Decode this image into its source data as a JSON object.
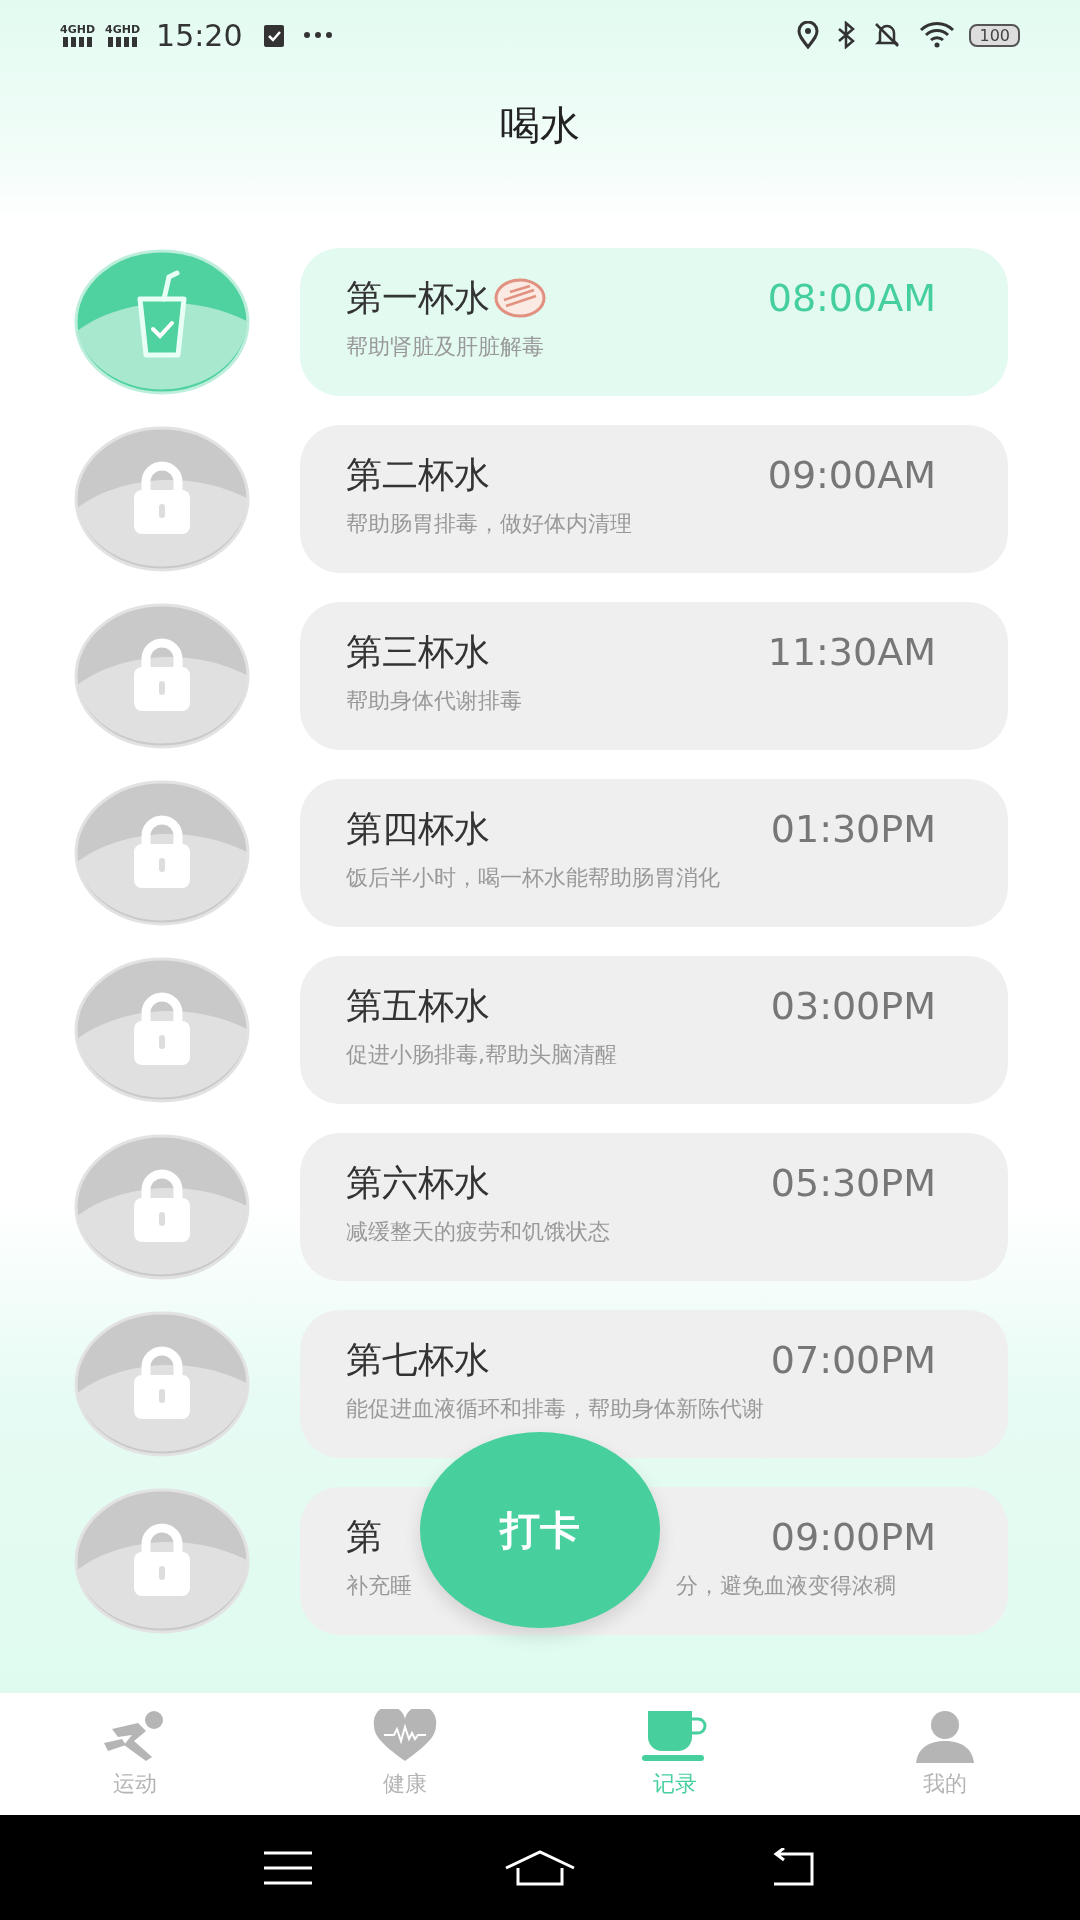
{
  "status_bar": {
    "networks": [
      "4GHD",
      "4GHD"
    ],
    "time": "15:20",
    "battery": "100"
  },
  "title": "喝水",
  "cups": [
    {
      "title": "第一杯水",
      "description": [
        "帮助肾脏及肝脏解毒"
      ],
      "time": "08:00AM",
      "done": true
    },
    {
      "title": "第二杯水",
      "description": [
        "帮助肠胃排毒，做好体内清理"
      ],
      "time": "09:00AM",
      "done": false
    },
    {
      "title": "第三杯水",
      "description": [
        "帮助身体代谢排毒"
      ],
      "time": "11:30AM",
      "done": false
    },
    {
      "title": "第四杯水",
      "description": [
        "饭后半小时，喝一杯水能帮助肠胃消化"
      ],
      "time": "01:30PM",
      "done": false
    },
    {
      "title": "第五杯水",
      "description": [
        "促进小肠排毒,帮助头脑清醒"
      ],
      "time": "03:00PM",
      "done": false
    },
    {
      "title": "第六杯水",
      "description": [
        "减缓整天的疲劳和饥饿状态"
      ],
      "time": "05:30PM",
      "done": false
    },
    {
      "title": "第七杯水",
      "description": [
        "能促进血液循环和排毒，帮助身体新陈代谢"
      ],
      "time": "07:00PM",
      "done": false
    },
    {
      "title": "第",
      "description": [
        "补充睡",
        "分，避免血液变得浓稠"
      ],
      "time": "09:00PM",
      "done": false
    }
  ],
  "check_in_button": "打卡",
  "tabs": [
    {
      "label": "运动",
      "kind": "run",
      "selected": false
    },
    {
      "label": "健康",
      "kind": "heart",
      "selected": false
    },
    {
      "label": "记录",
      "kind": "cup",
      "selected": true
    },
    {
      "label": "我的",
      "kind": "person",
      "selected": false
    }
  ]
}
